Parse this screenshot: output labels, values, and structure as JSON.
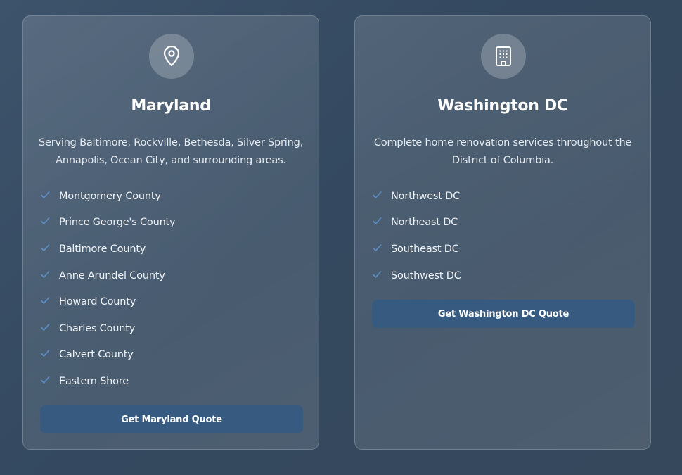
{
  "colors": {
    "accent_button": "#375a80",
    "check": "#5b8fc7",
    "background": "#3a4f66"
  },
  "cards": [
    {
      "icon": "map-pin-icon",
      "title": "Maryland",
      "description": "Serving Baltimore, Rockville, Bethesda, Silver Spring, Annapolis, Ocean City, and surrounding areas.",
      "items": [
        "Montgomery County",
        "Prince George's County",
        "Baltimore County",
        "Anne Arundel County",
        "Howard County",
        "Charles County",
        "Calvert County",
        "Eastern Shore"
      ],
      "button_label": "Get Maryland Quote"
    },
    {
      "icon": "building-icon",
      "title": "Washington DC",
      "description": "Complete home renovation services throughout the District of Columbia.",
      "items": [
        "Northwest DC",
        "Northeast DC",
        "Southeast DC",
        "Southwest DC"
      ],
      "button_label": "Get Washington DC Quote"
    }
  ]
}
